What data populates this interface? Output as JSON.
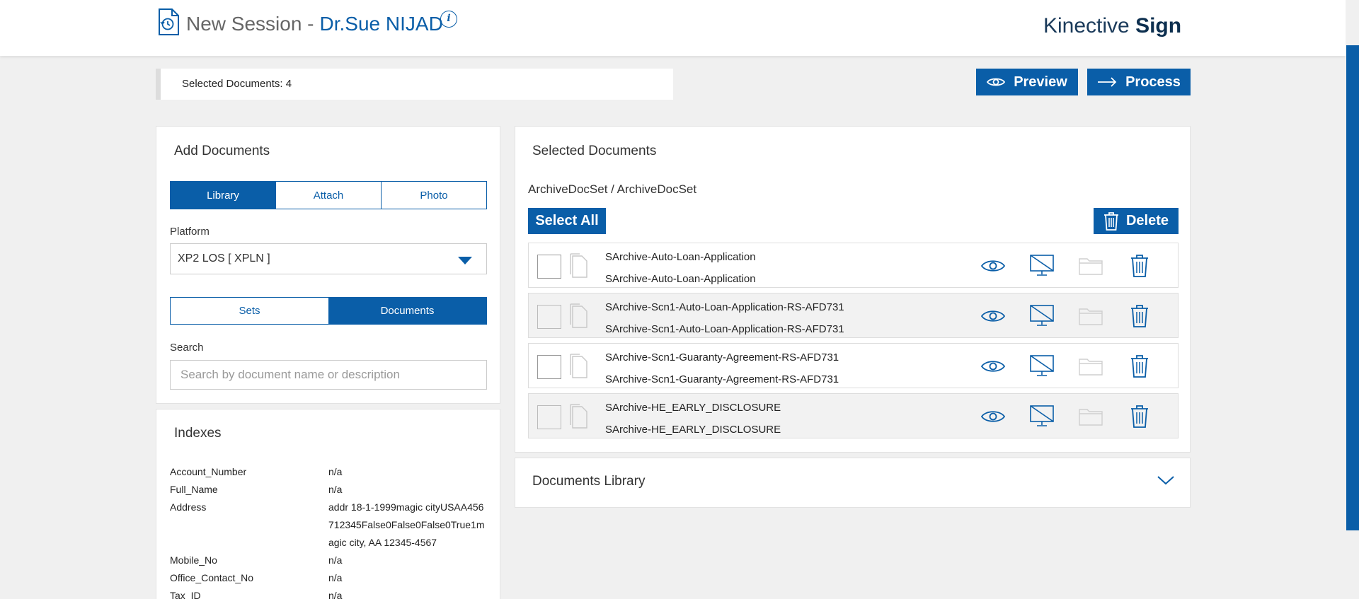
{
  "header": {
    "title_prefix": "New Session -",
    "session_user": "Dr.Sue NIJAD",
    "info_glyph": "i",
    "brand_left": "Kinective",
    "brand_right": "Sign"
  },
  "toolbar": {
    "selected_count_label": "Selected Documents: 4",
    "preview_label": "Preview",
    "process_label": "Process"
  },
  "add_documents": {
    "title": "Add Documents",
    "source_tabs": [
      "Library",
      "Attach",
      "Photo"
    ],
    "platform_label": "Platform",
    "platform_value": "XP2 LOS [ XPLN ]",
    "view_tabs": [
      "Sets",
      "Documents"
    ],
    "search_label": "Search",
    "search_placeholder": "Search by document name or description"
  },
  "indexes": {
    "title": "Indexes",
    "rows": [
      {
        "key": "Account_Number",
        "value": "n/a"
      },
      {
        "key": "Full_Name",
        "value": "n/a"
      },
      {
        "key": "Address",
        "value": "addr 18-1-1999magic cityUSAA456712345False0False0False0True1magic city, AA 12345-4567"
      },
      {
        "key": "Mobile_No",
        "value": "n/a"
      },
      {
        "key": "Office_Contact_No",
        "value": "n/a"
      },
      {
        "key": "Tax_ID",
        "value": "n/a"
      }
    ]
  },
  "selected_documents": {
    "title": "Selected Documents",
    "breadcrumb": "ArchiveDocSet / ArchiveDocSet",
    "select_all_label": "Select All",
    "delete_label": "Delete",
    "documents": [
      {
        "name": "SArchive-Auto-Loan-Application",
        "description": "SArchive-Auto-Loan-Application"
      },
      {
        "name": "SArchive-Scn1-Auto-Loan-Application-RS-AFD731",
        "description": "SArchive-Scn1-Auto-Loan-Application-RS-AFD731"
      },
      {
        "name": "SArchive-Scn1-Guaranty-Agreement-RS-AFD731",
        "description": "SArchive-Scn1-Guaranty-Agreement-RS-AFD731"
      },
      {
        "name": "SArchive-HE_EARLY_DISCLOSURE",
        "description": "SArchive-HE_EARLY_DISCLOSURE"
      }
    ]
  },
  "documents_library": {
    "title": "Documents Library"
  },
  "colors": {
    "accent": "#0a5ea8",
    "page_bg": "#f0f0f0",
    "row_alt_bg": "#f2f2f2"
  }
}
